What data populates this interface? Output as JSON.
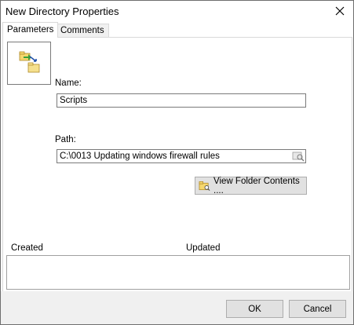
{
  "window": {
    "title": "New Directory Properties"
  },
  "tabs": [
    {
      "label": "Parameters",
      "active": true
    },
    {
      "label": "Comments",
      "active": false
    }
  ],
  "form": {
    "name_label": "Name:",
    "name_value": "Scripts",
    "path_label": "Path:",
    "path_value": "C:\\0013 Updating windows firewall rules",
    "view_folder_label": "View Folder Contents ...."
  },
  "info": {
    "created_label": "Created",
    "updated_label": "Updated"
  },
  "buttons": {
    "ok": "OK",
    "cancel": "Cancel"
  },
  "icons": {
    "directory": "new-directory-icon",
    "browse": "browse-folder-icon",
    "view_folder": "folder-search-icon",
    "close": "close-icon"
  },
  "colors": {
    "footer_bg": "#f0f0f0",
    "button_bg": "#e1e1e1",
    "folder_yellow": "#f5d76e"
  }
}
